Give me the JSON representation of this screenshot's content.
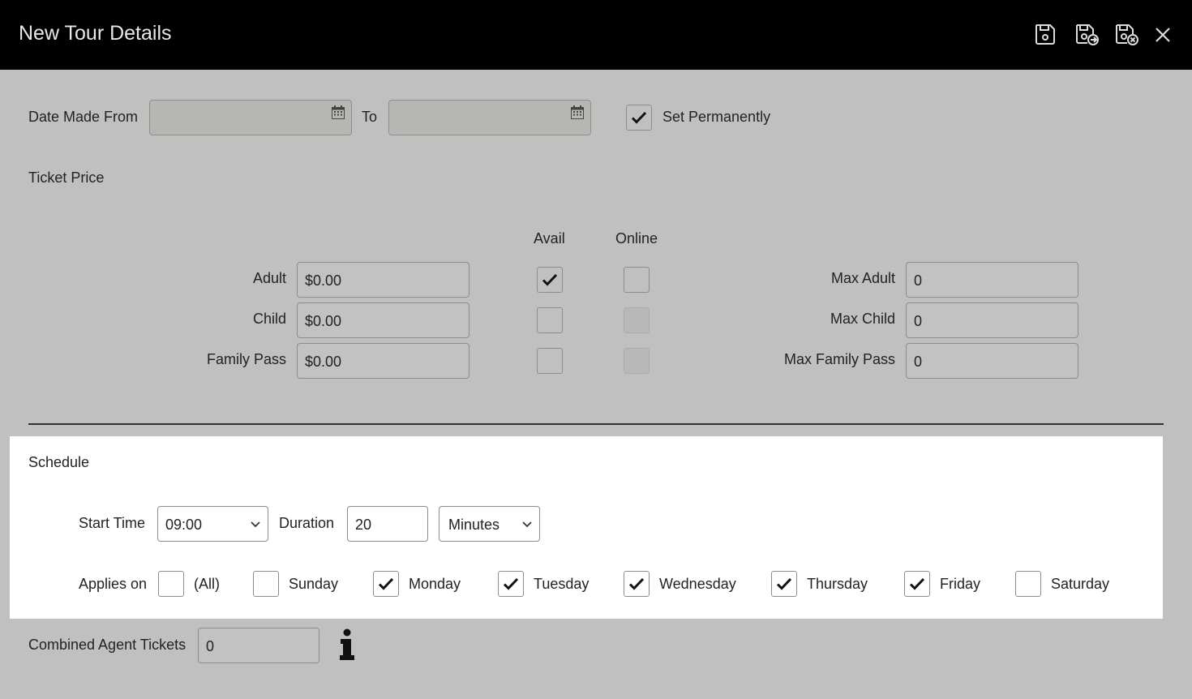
{
  "window": {
    "title": "New Tour Details",
    "toolbar_icons": [
      "save-icon",
      "save-and-new-icon",
      "save-and-close-icon",
      "close-icon"
    ]
  },
  "date_range": {
    "from_label": "Date Made From",
    "from_value": "",
    "to_label": "To",
    "to_value": "",
    "set_permanently_label": "Set Permanently",
    "set_permanently_checked": true
  },
  "ticket_price": {
    "section_label": "Ticket Price",
    "avail_header": "Avail",
    "online_header": "Online",
    "rows": [
      {
        "label": "Adult",
        "price": "$0.00",
        "avail": true,
        "online": false,
        "online_enabled": true,
        "max_label": "Max Adult",
        "max_value": "0"
      },
      {
        "label": "Child",
        "price": "$0.00",
        "avail": false,
        "online": false,
        "online_enabled": false,
        "max_label": "Max Child",
        "max_value": "0"
      },
      {
        "label": "Family Pass",
        "price": "$0.00",
        "avail": false,
        "online": false,
        "online_enabled": false,
        "max_label": "Max Family Pass",
        "max_value": "0"
      }
    ]
  },
  "schedule": {
    "section_label": "Schedule",
    "start_time_label": "Start Time",
    "start_time_value": "09:00",
    "duration_label": "Duration",
    "duration_value": "20",
    "duration_unit": "Minutes",
    "applies_on_label": "Applies on",
    "days": [
      {
        "label": "(All)",
        "checked": false
      },
      {
        "label": "Sunday",
        "checked": false
      },
      {
        "label": "Monday",
        "checked": true
      },
      {
        "label": "Tuesday",
        "checked": true
      },
      {
        "label": "Wednesday",
        "checked": true
      },
      {
        "label": "Thursday",
        "checked": true
      },
      {
        "label": "Friday",
        "checked": true
      },
      {
        "label": "Saturday",
        "checked": false
      }
    ]
  },
  "combined_agent": {
    "label": "Combined Agent Tickets",
    "value": "0"
  },
  "colors": {
    "titlebar": "#000000",
    "background": "#c0c0c0",
    "panel": "#ffffff"
  }
}
